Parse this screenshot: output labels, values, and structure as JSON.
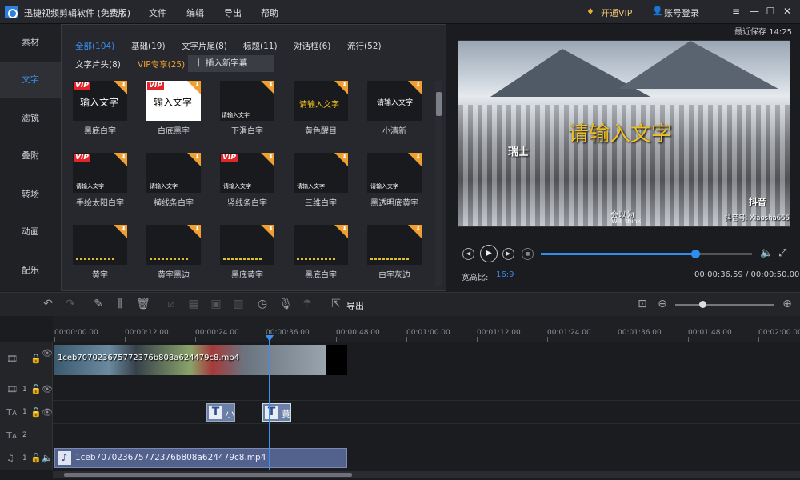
{
  "app": {
    "title": "迅捷视频剪辑软件 (免费版)",
    "menu": [
      "文件",
      "编辑",
      "导出",
      "帮助"
    ],
    "vip_label": "开通VIP",
    "account_label": "账号登录"
  },
  "sidebar": {
    "items": [
      "素材",
      "文字",
      "滤镜",
      "叠附",
      "转场",
      "动画",
      "配乐"
    ],
    "active": 1
  },
  "text_panel": {
    "categories_row1": [
      "全部(104)",
      "基础(19)",
      "文字片尾(8)",
      "标题(11)",
      "对话框(6)",
      "流行(52)"
    ],
    "categories_row2": [
      "文字片头(8)",
      "VIP专享(25)"
    ],
    "insert_label": "十 插入新字幕",
    "templates": [
      {
        "label": "黑底白字",
        "sample": "输入文字",
        "vip": true
      },
      {
        "label": "白底黑字",
        "sample": "输入文字",
        "vip": true
      },
      {
        "label": "下滑白字",
        "sample": "请输入文字"
      },
      {
        "label": "黄色醒目",
        "sample": "请输入文字"
      },
      {
        "label": "小清新",
        "sample": "请输入文字"
      },
      {
        "label": "手绘太阳白字",
        "sample": "请输入文字",
        "vip": true
      },
      {
        "label": "横线条白字",
        "sample": "请输入文字"
      },
      {
        "label": "竖线条白字",
        "sample": "请输入文字",
        "vip": true
      },
      {
        "label": "三维白字",
        "sample": "请输入文字"
      },
      {
        "label": "黑透明底黄字",
        "sample": "请输入文字"
      },
      {
        "label": "黄字",
        "sample": ""
      },
      {
        "label": "黄字黑边",
        "sample": ""
      },
      {
        "label": "黑底黄字",
        "sample": ""
      },
      {
        "label": "黑底白字",
        "sample": ""
      },
      {
        "label": "白字灰边",
        "sample": ""
      }
    ],
    "vip_badge": "VIP"
  },
  "preview": {
    "save_status": "最近保存 14:25",
    "overlay_text": "请输入文字",
    "caption_left": "瑞士",
    "subtitle_cn": "会以为",
    "subtitle_en": "Will think",
    "watermark_brand": "抖音",
    "watermark_id": "抖音号: Xiaosha666",
    "progress": 0.73,
    "aspect_label": "宽高比:",
    "aspect_value": "16:9",
    "time": "00:00:36.59 / 00:00:50.00"
  },
  "toolbar": {
    "export_label": "导出"
  },
  "ruler": {
    "labels": [
      "00:00:00.00",
      "00:00:12.00",
      "00:00:24.00",
      "00:00:36.00",
      "00:00:48.00",
      "00:01:00.00",
      "00:01:12.00",
      "00:01:24.00",
      "00:01:36.00",
      "00:01:48.00",
      "00:02:00.00"
    ]
  },
  "timeline": {
    "video_clip": "1ceb707023675772376b808a624479c8.mp4",
    "text_clip_1": "小",
    "text_clip_2": "黄",
    "audio_clip": "1ceb707023675772376b808a624479c8.mp4",
    "track_nums": [
      "1",
      "1",
      "2",
      "1"
    ]
  }
}
